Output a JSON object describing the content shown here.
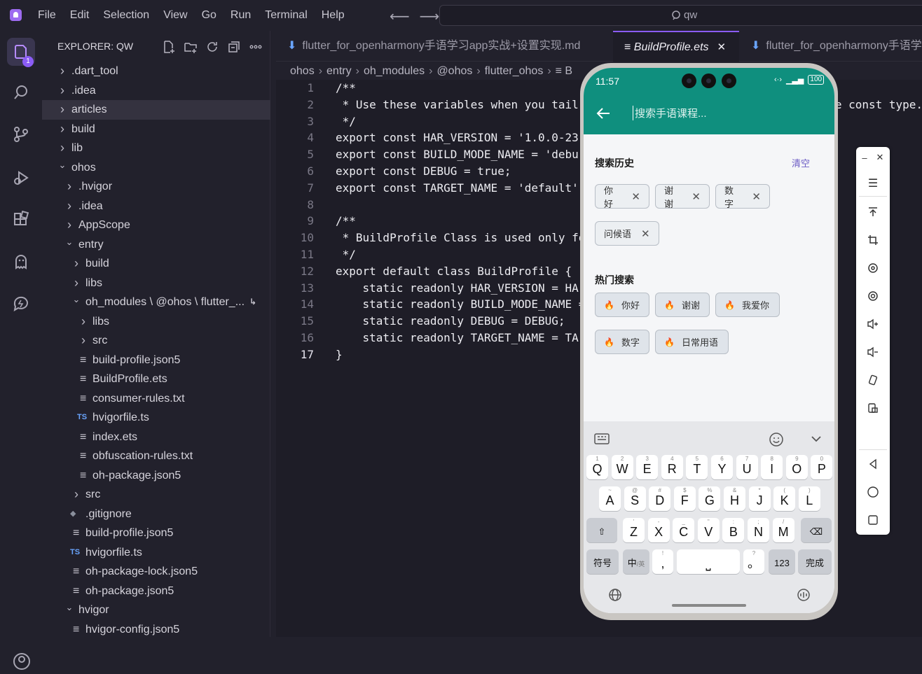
{
  "menu": [
    "File",
    "Edit",
    "Selection",
    "View",
    "Go",
    "Run",
    "Terminal",
    "Help"
  ],
  "search": {
    "text": "qw"
  },
  "activity": {
    "badge": "1"
  },
  "explorer": {
    "title": "EXPLORER: QW",
    "items": [
      {
        "label": ".dart_tool",
        "type": "folder",
        "open": false,
        "depth": 0
      },
      {
        "label": ".idea",
        "type": "folder",
        "open": false,
        "depth": 0
      },
      {
        "label": "articles",
        "type": "folder",
        "open": false,
        "depth": 0,
        "selected": true
      },
      {
        "label": "build",
        "type": "folder",
        "open": false,
        "depth": 0
      },
      {
        "label": "lib",
        "type": "folder",
        "open": false,
        "depth": 0
      },
      {
        "label": "ohos",
        "type": "folder",
        "open": true,
        "depth": 0
      },
      {
        "label": ".hvigor",
        "type": "folder",
        "open": false,
        "depth": 1
      },
      {
        "label": ".idea",
        "type": "folder",
        "open": false,
        "depth": 1
      },
      {
        "label": "AppScope",
        "type": "folder",
        "open": false,
        "depth": 1
      },
      {
        "label": "entry",
        "type": "folder",
        "open": true,
        "depth": 1
      },
      {
        "label": "build",
        "type": "folder",
        "open": false,
        "depth": 2
      },
      {
        "label": "libs",
        "type": "folder",
        "open": false,
        "depth": 2
      },
      {
        "label": "oh_modules \\ @ohos \\ flutter_...",
        "type": "folder",
        "open": true,
        "depth": 2,
        "link": true
      },
      {
        "label": "libs",
        "type": "folder",
        "open": false,
        "depth": 3
      },
      {
        "label": "src",
        "type": "folder",
        "open": false,
        "depth": 3
      },
      {
        "label": "build-profile.json5",
        "type": "file",
        "depth": 3
      },
      {
        "label": "BuildProfile.ets",
        "type": "file",
        "depth": 3
      },
      {
        "label": "consumer-rules.txt",
        "type": "file",
        "depth": 3
      },
      {
        "label": "hvigorfile.ts",
        "type": "ts",
        "depth": 3
      },
      {
        "label": "index.ets",
        "type": "file",
        "depth": 3
      },
      {
        "label": "obfuscation-rules.txt",
        "type": "file",
        "depth": 3
      },
      {
        "label": "oh-package.json5",
        "type": "file",
        "depth": 3
      },
      {
        "label": "src",
        "type": "folder",
        "open": false,
        "depth": 2
      },
      {
        "label": ".gitignore",
        "type": "git",
        "depth": 2
      },
      {
        "label": "build-profile.json5",
        "type": "file",
        "depth": 2
      },
      {
        "label": "hvigorfile.ts",
        "type": "ts",
        "depth": 2
      },
      {
        "label": "oh-package-lock.json5",
        "type": "file",
        "depth": 2
      },
      {
        "label": "oh-package.json5",
        "type": "file",
        "depth": 2
      },
      {
        "label": "hvigor",
        "type": "folder",
        "open": true,
        "depth": 1
      },
      {
        "label": "hvigor-config.json5",
        "type": "file",
        "depth": 2
      }
    ],
    "ts_tag": "TS"
  },
  "tabs": [
    {
      "label": "flutter_for_openharmony手语学习app实战+设置实现.md",
      "active": false
    },
    {
      "label": "BuildProfile.ets",
      "active": true,
      "close": "✕"
    },
    {
      "label": "flutter_for_openharmony手语学",
      "active": false
    }
  ],
  "breadcrumb": [
    "ohos",
    "entry",
    "oh_modules",
    "@ohos",
    "flutter_ohos",
    "B"
  ],
  "code": {
    "line_numbers": [
      "1",
      "2",
      "3",
      "4",
      "5",
      "6",
      "7",
      "8",
      "9",
      "10",
      "11",
      "12",
      "13",
      "14",
      "15",
      "16",
      "17"
    ],
    "current_line": 17,
    "lines": [
      "/**",
      " * Use these variables when you tail                                      e const type.",
      " */",
      "export const HAR_VERSION = '1.0.0-23",
      "export const BUILD_MODE_NAME = 'debu",
      "export const DEBUG = true;",
      "export const TARGET_NAME = 'default'",
      "",
      "/**",
      " * BuildProfile Class is used only fo",
      " */",
      "export default class BuildProfile {",
      "    static readonly HAR_VERSION = HA",
      "    static readonly BUILD_MODE_NAME =",
      "    static readonly DEBUG = DEBUG;",
      "    static readonly TARGET_NAME = TA",
      "}"
    ]
  },
  "phone": {
    "time": "11:57",
    "battery": "100",
    "search_placeholder": "搜索手语课程...",
    "history_title": "搜索历史",
    "clear_label": "清空",
    "history": [
      "你好",
      "谢谢",
      "数字",
      "问候语"
    ],
    "hot_title": "热门搜索",
    "hot": [
      "你好",
      "谢谢",
      "我爱你",
      "数字",
      "日常用语"
    ],
    "keyboard": {
      "row1": [
        [
          "Q",
          "1"
        ],
        [
          "W",
          "2"
        ],
        [
          "E",
          "3"
        ],
        [
          "R",
          "4"
        ],
        [
          "T",
          "5"
        ],
        [
          "Y",
          "6"
        ],
        [
          "U",
          "7"
        ],
        [
          "I",
          "8"
        ],
        [
          "O",
          "9"
        ],
        [
          "P",
          "0"
        ]
      ],
      "row2": [
        [
          "A",
          "~"
        ],
        [
          "S",
          "@"
        ],
        [
          "D",
          "#"
        ],
        [
          "F",
          "$"
        ],
        [
          "G",
          "%"
        ],
        [
          "H",
          "&"
        ],
        [
          "J",
          "*"
        ],
        [
          "K",
          "("
        ],
        [
          "L",
          ")"
        ]
      ],
      "row3": [
        [
          "Z",
          "'"
        ],
        [
          "X",
          "-"
        ],
        [
          "C",
          "_"
        ],
        [
          "V",
          "\""
        ],
        [
          "B",
          ":"
        ],
        [
          "N",
          ";"
        ],
        [
          "M",
          "/"
        ]
      ],
      "symbol_key": "符号",
      "lang_key": "中",
      "lang_sub": "/英",
      "comma": ",",
      "comma_sup": "!",
      "period": "。",
      "period_sup": "?",
      "num_key": "123",
      "done_key": "完成"
    }
  },
  "colors": {
    "accent": "#8b5cf6",
    "phone_bar": "#0f8f7e"
  }
}
